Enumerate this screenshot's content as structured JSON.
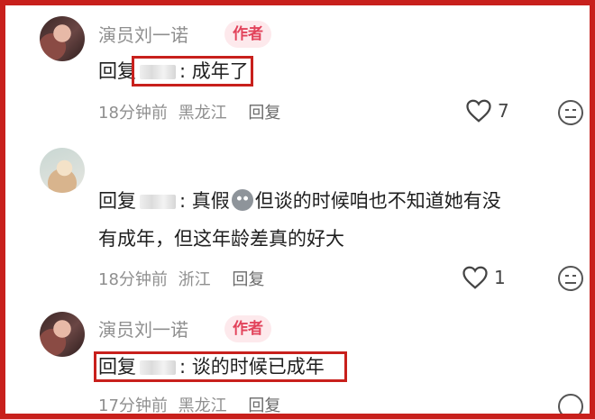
{
  "comments": [
    {
      "author": "演员刘一诺",
      "badge": "作者",
      "reply_prefix": "回复",
      "text": ": 成年了",
      "time": "18分钟前",
      "location": "黑龙江",
      "reply_label": "回复",
      "likes": "7"
    },
    {
      "author": "",
      "reply_prefix": "回复",
      "text_line1": ": 真假",
      "text_line1b": "但谈的时候咱也不知道她有没",
      "text_line2": "有成年，但这年龄差真的好大",
      "time": "18分钟前",
      "location": "浙江",
      "reply_label": "回复",
      "likes": "1"
    },
    {
      "author": "演员刘一诺",
      "badge": "作者",
      "reply_prefix": "回复",
      "text": ": 谈的时候已成年",
      "time": "17分钟前",
      "location": "黑龙江",
      "reply_label": "回复"
    }
  ],
  "icons": {
    "like": "heart-outline-icon",
    "dislike": "meh-face-icon"
  },
  "colors": {
    "frame": "#c8201c",
    "badge_bg": "#fde9ec",
    "badge_text": "#e2435b",
    "meta_text": "#8f8f8f"
  }
}
